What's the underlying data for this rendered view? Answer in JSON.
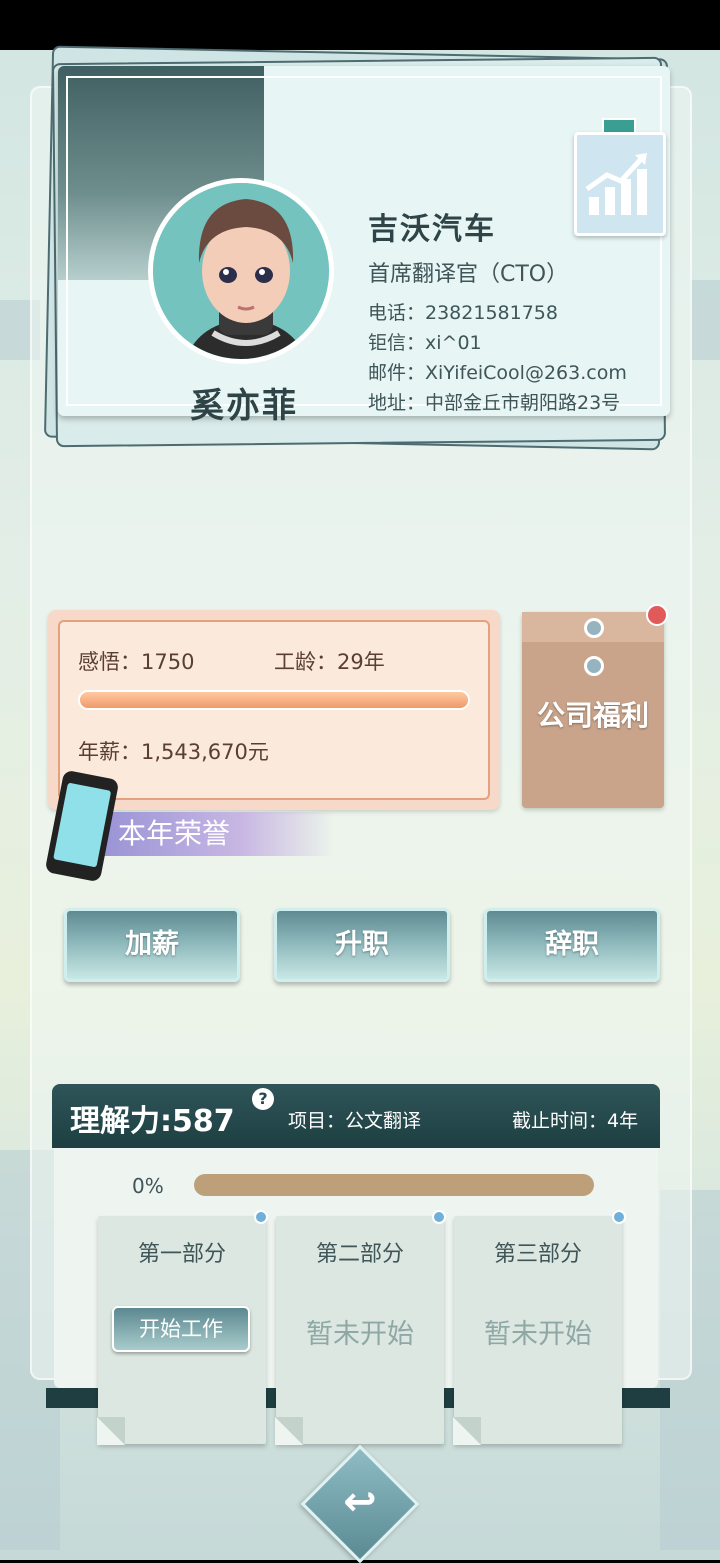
{
  "card": {
    "name": "奚亦菲",
    "company": "吉沃汽车",
    "title": "首席翻译官（CTO）",
    "phone": "电话：23821581758",
    "chat": "钜信：xi^01",
    "email": "邮件：XiYifeiCool@263.com",
    "address": "地址：中部金丘市朝阳路23号"
  },
  "stats": {
    "insight": "感悟：1750",
    "seniority": "工龄：29年",
    "salary": "年薪：1,543,670元",
    "progress": 1.0
  },
  "welfare": {
    "label": "公司福利"
  },
  "honor": {
    "label": "本年荣誉"
  },
  "actions": {
    "raise": "加薪",
    "promote": "升职",
    "resign": "辞职"
  },
  "project": {
    "ability": "理解力:587",
    "help": "?",
    "item": "项目：公文翻译",
    "deadline": "截止时间：4年",
    "percent_label": "0%",
    "percent": 0,
    "parts": [
      {
        "title": "第一部分",
        "status": "",
        "button": "开始工作"
      },
      {
        "title": "第二部分",
        "status": "暂未开始"
      },
      {
        "title": "第三部分",
        "status": "暂未开始"
      }
    ]
  },
  "icons": [
    "chart-growth-icon",
    "phone-icon",
    "help-icon",
    "back-icon",
    "notification-dot-icon"
  ],
  "colors": {
    "header_dark": "#1d3f42",
    "accent_orange": "#f09a6a",
    "welfare_brown": "#c9a48a"
  }
}
